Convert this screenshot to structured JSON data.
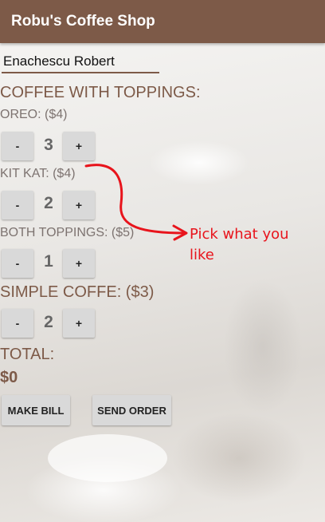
{
  "app_bar": {
    "title": "Robu's Coffee Shop"
  },
  "name_field": {
    "value": "Enachescu Robert"
  },
  "section_heading": "COFFEE WITH TOPPINGS:",
  "items": [
    {
      "label": "OREO: ($4)",
      "minus": "-",
      "qty": "3",
      "plus": "+"
    },
    {
      "label": "KIT KAT: ($4)",
      "minus": "-",
      "qty": "2",
      "plus": "+"
    },
    {
      "label": "BOTH TOPPINGS: ($5)",
      "minus": "-",
      "qty": "1",
      "plus": "+"
    },
    {
      "label": "SIMPLE COFFE: ($3)",
      "minus": "-",
      "qty": "2",
      "plus": "+"
    }
  ],
  "total": {
    "label": "TOTAL:",
    "value": "$0"
  },
  "buttons": {
    "make_bill": "MAKE BILL",
    "send_order": "SEND ORDER"
  },
  "annotation": {
    "line1": "Pick what you",
    "line2": "like",
    "color": "#e8141c"
  },
  "colors": {
    "app_bar": "#7d5a48",
    "accent_text": "#7d5a48"
  }
}
